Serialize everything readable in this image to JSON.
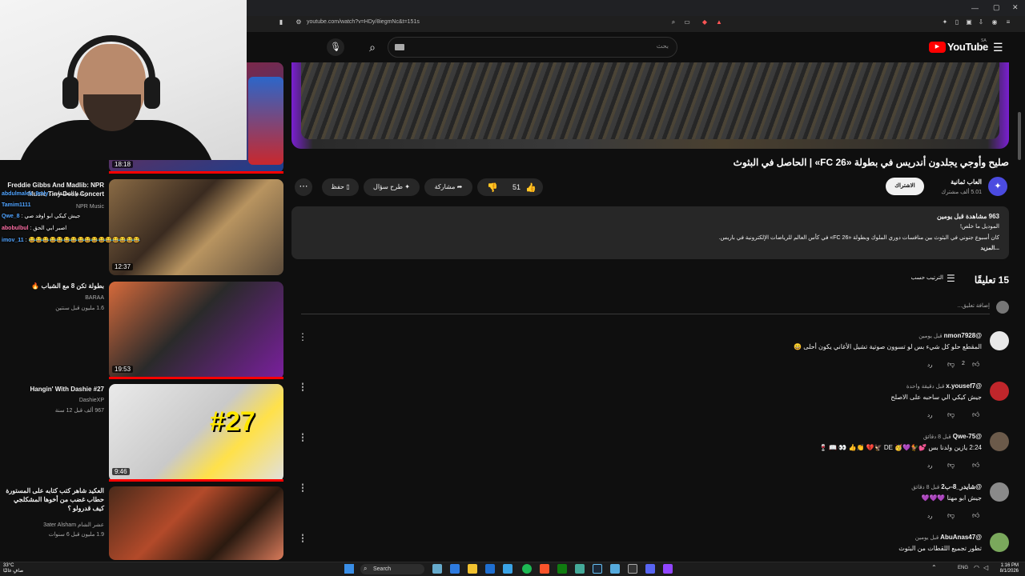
{
  "browser": {
    "url": "youtube.com/watch?v=HDy/8iegmNc&t=151s"
  },
  "header": {
    "search_placeholder": "بحث",
    "logo_text": "YouTube",
    "region": "SA"
  },
  "video": {
    "title": "صليح وأوجي يجلدون أندريس في بطولة «FC 26» | الحاصل في البثوث",
    "channel_name": "العاب ثمانية",
    "subscribers": "5.01 ألف مشترك",
    "subscribe_label": "الاشتراك",
    "likes": "51",
    "share_label": "مشاركة",
    "ask_label": "طرح سؤال",
    "save_label": "حفظ"
  },
  "description": {
    "stats": "963 مشاهدة  قبل يومين",
    "line1": "الموديل ما خلص!",
    "line2": "كان أسبوع جنوني في البثوث بين منافسات دوري الملوك وبطولة «FC 26» في كأس العالم للرياضات الإلكترونية في باريس.",
    "more": "...المزيد"
  },
  "comments": {
    "count_label": "15 تعليقًا",
    "sort_label": "الترتيب حسب",
    "add_placeholder": "إضافة تعليق...",
    "reply_label": "رد",
    "items": [
      {
        "author": "@nmon7928",
        "time": "قبل يومين",
        "text": "المقطع حلو كل شيء بس لو تسوون صوتية تشيل الأغاني يكون أحلى 😄",
        "likes": "2",
        "avatar_color": "#e8e8e8"
      },
      {
        "author": "@x.yousef7",
        "time": "قبل دقيقة واحدة",
        "text": "جيش كيكي الي ساحبه على الاصلح",
        "likes": "",
        "avatar_color": "#c0262b"
      },
      {
        "author": "@Qwe-75",
        "time": "قبل 8 دقائق",
        "text": "2:24 يازين ولدنا بس 💕🐓💜🥳 DE 🦅💔 👏👍 👀 📖 🍷",
        "likes": "",
        "avatar_color": "#6b5a4a"
      },
      {
        "author": "@شايدر_8-ب2",
        "time": "قبل 8 دقائق",
        "text": "جيش ابو مهنا 💜💜💜",
        "likes": "",
        "avatar_color": "#8a8a8a"
      },
      {
        "author": "@AbuAnas47",
        "time": "قبل يومين",
        "text": "تطور تجميع اللقطات من البثوث",
        "likes": "",
        "avatar_color": "#7aa85c"
      }
    ]
  },
  "suggestions": [
    {
      "title": "Freddie Gibbs And Madlib: NPR Music Tiny Desk Concert",
      "channel": "NPR Music",
      "meta": "",
      "duration": "12:37"
    },
    {
      "title": "بطولة تكن 8 مع الشباب 🔥",
      "channel": "BARAA",
      "meta": "1.6 مليون  قبل سنتين",
      "duration": "19:53"
    },
    {
      "title": "Hangin' With Dashie #27",
      "channel": "DashieXP",
      "meta": "967 ألف  قبل 12 سنة",
      "duration": "9:46"
    },
    {
      "title": "العكيد شاهر كتب كتابه على المستورة حطاب غضب من أخوها المشكلجي كيف قدرولو ؟",
      "channel": "عشر الشام 3ater Alsham",
      "meta": "1.9 مليون  قبل 6 سنوات",
      "duration": ""
    }
  ],
  "top_thumb_duration": "18:18",
  "chat": [
    {
      "user": "abdulmalek_9mly",
      "msg": ": ريادم التعليقات"
    },
    {
      "user": "Tamim1111",
      "msg": ": Music"
    },
    {
      "user": "Qwe_8",
      "msg": ": جيش كيكي ابو اوفد صي"
    },
    {
      "user": "abobulbul",
      "msg": ": اصبر ابي الحق"
    },
    {
      "user": "imov_11",
      "msg": ": 😂😂😂😂😂😂😂😂😂😂😂😂😂😂😂😂"
    }
  ],
  "taskbar": {
    "search_label": "Search",
    "weather": "33°C",
    "weather_desc": "صافٍ غالبًا",
    "lang": "ENG",
    "time": "1:16 PM",
    "date": "8/1/2026"
  }
}
